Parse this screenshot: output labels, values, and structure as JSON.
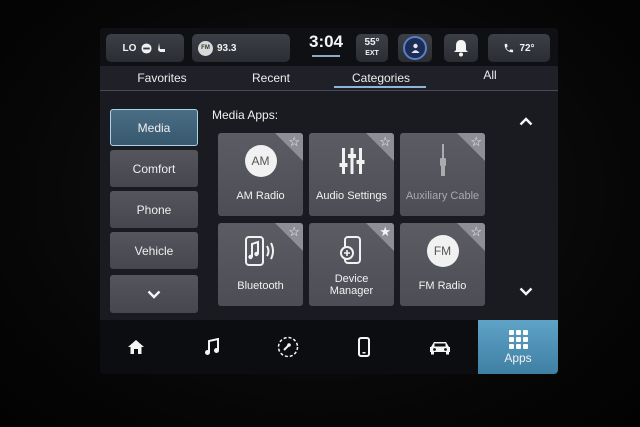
{
  "status": {
    "climate": {
      "label": "LO"
    },
    "radio": {
      "badge": "FM",
      "station": "93.3"
    },
    "clock": "3:04",
    "outside_temp": {
      "value": "55°",
      "label": "EXT"
    },
    "cabin_temp": "72°"
  },
  "tabs": [
    {
      "label": "Favorites",
      "active": false
    },
    {
      "label": "Recent",
      "active": false
    },
    {
      "label": "Categories",
      "active": true
    },
    {
      "label": "All",
      "active": false
    }
  ],
  "categories": [
    {
      "label": "Media",
      "active": true
    },
    {
      "label": "Comfort",
      "active": false
    },
    {
      "label": "Phone",
      "active": false
    },
    {
      "label": "Vehicle",
      "active": false
    }
  ],
  "section_label": "Media Apps:",
  "apps": [
    {
      "label": "AM Radio",
      "icon": "am-radio-icon",
      "badge": "AM",
      "favorite": false
    },
    {
      "label": "Audio Settings",
      "icon": "equalizer-icon",
      "favorite": false
    },
    {
      "label": "Auxiliary Cable",
      "icon": "aux-cable-icon",
      "favorite": false,
      "disabled": true
    },
    {
      "label": "Bluetooth",
      "icon": "bluetooth-audio-icon",
      "favorite": false
    },
    {
      "label": "Device Manager",
      "icon": "device-manager-icon",
      "favorite": true
    },
    {
      "label": "FM Radio",
      "icon": "fm-radio-icon",
      "badge": "FM",
      "favorite": false
    }
  ],
  "bottom_nav": {
    "apps_label": "Apps",
    "items": [
      "home-icon",
      "music-note-icon",
      "performance-gauge-icon",
      "phone-device-icon",
      "vehicle-icon",
      "apps-grid-icon"
    ]
  },
  "colors": {
    "accent": "#4a8db3",
    "active_border": "#a9d2ea",
    "tile": "#55565e"
  }
}
